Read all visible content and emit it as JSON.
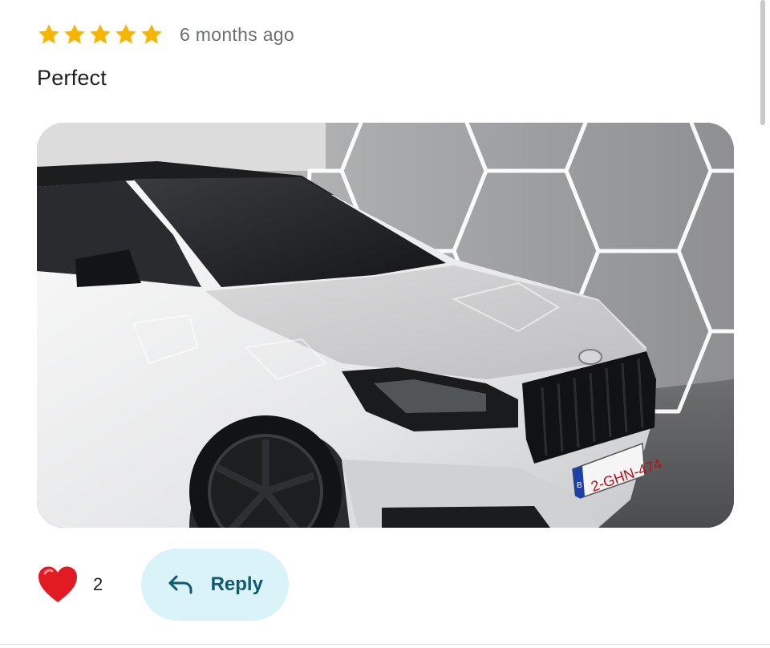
{
  "review": {
    "rating": 5,
    "rating_max": 5,
    "time_ago": "6 months ago",
    "text": "Perfect",
    "star_color": "#f7b500"
  },
  "photo": {
    "plate_text": "2-GHN-474",
    "plate_country": "B"
  },
  "actions": {
    "like_count": "2",
    "reply_label": "Reply",
    "heart_color": "#e21b23",
    "reply_bg": "#d9f3f8",
    "reply_text_color": "#0e5a6e"
  }
}
